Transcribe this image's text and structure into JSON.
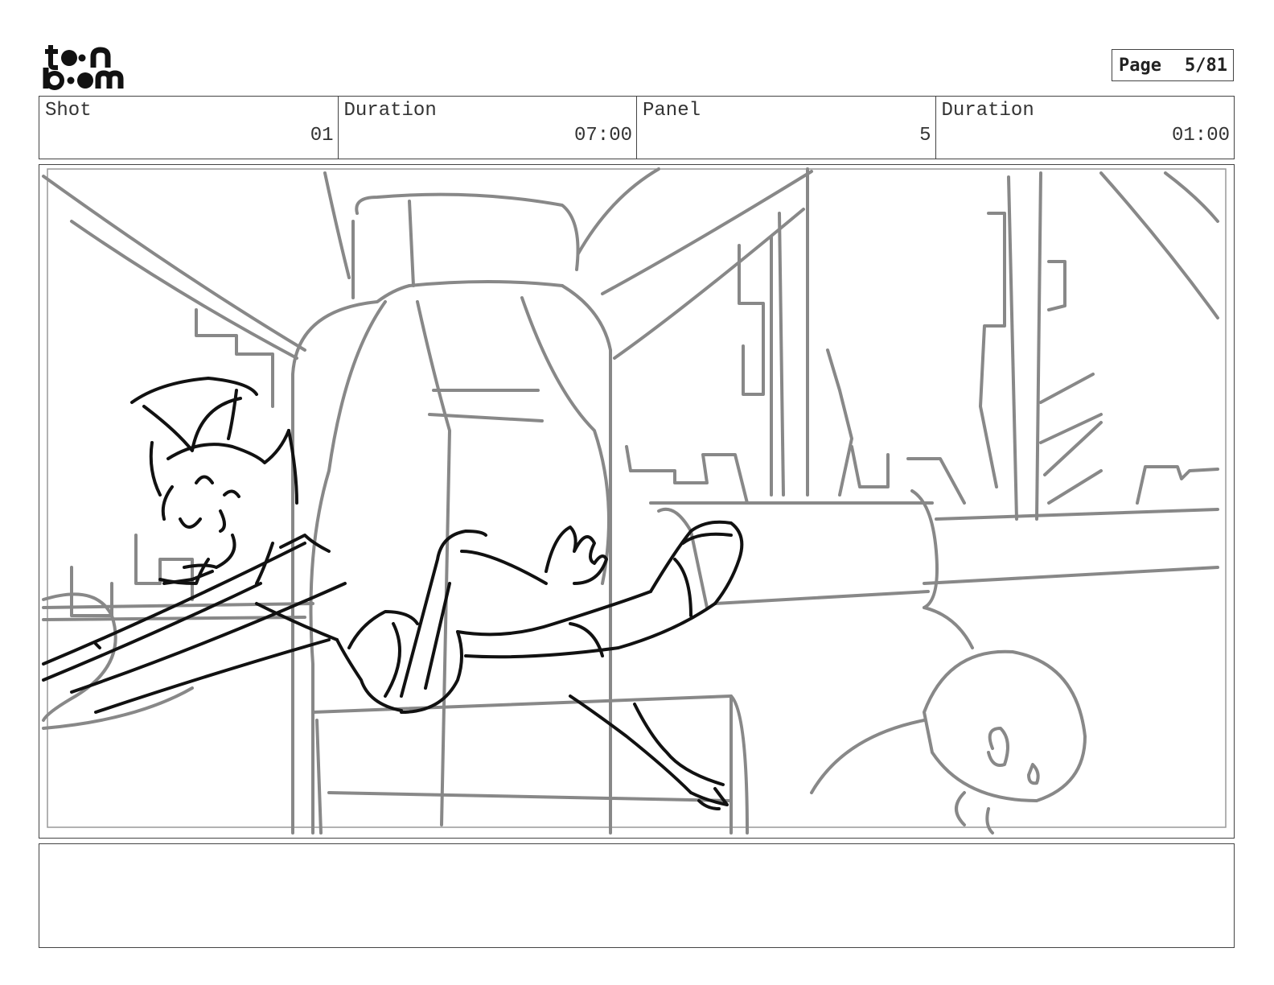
{
  "header": {
    "logo_text": [
      "to",
      "n",
      "b",
      "m"
    ],
    "page_label": "Page",
    "page_number": "5/81"
  },
  "info": [
    {
      "label": "Shot",
      "value": "01"
    },
    {
      "label": "Duration",
      "value": "07:00"
    },
    {
      "label": "Panel",
      "value": "5"
    },
    {
      "label": "Duration",
      "value": "01:00"
    }
  ],
  "sketch": {
    "background_color": "#888888",
    "character_color": "#111111"
  },
  "notes": {
    "text": ""
  }
}
